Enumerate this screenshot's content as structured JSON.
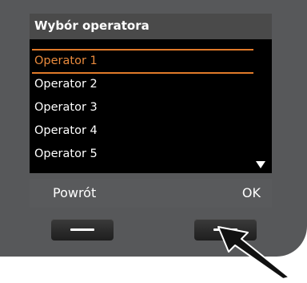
{
  "screen": {
    "title": "Wybór operatora",
    "items": [
      {
        "label": "Operator 1"
      },
      {
        "label": "Operator 2"
      },
      {
        "label": "Operator 3"
      },
      {
        "label": "Operator 4"
      },
      {
        "label": "Operator 5"
      }
    ],
    "selected_index": 0
  },
  "softkeys": {
    "left": "Powrót",
    "right": "OK"
  },
  "colors": {
    "device": "#57585a",
    "screen": "#000000",
    "highlight": "#e98a3d",
    "title_bar": "#4a4a4a"
  },
  "icons": {
    "scroll": "scroll-down-triangle-icon",
    "pointer": "pointer-arrow-icon"
  }
}
